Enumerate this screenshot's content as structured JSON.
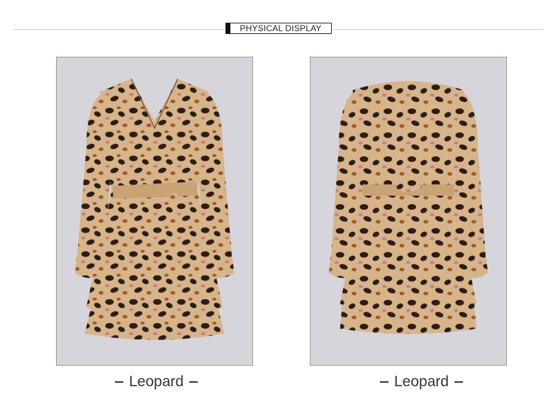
{
  "header": {
    "title": "PHYSICAL DISPLAY"
  },
  "photos": [
    {
      "view": "front",
      "caption": "Leopard"
    },
    {
      "view": "back",
      "caption": "Leopard"
    }
  ],
  "colors": {
    "fabric": "#d7b48a",
    "spot_dark": "#2b1d16",
    "spot_brown": "#9b5a2c",
    "spot_pink": "#c87a80",
    "backdrop": "#d6d5dc"
  }
}
